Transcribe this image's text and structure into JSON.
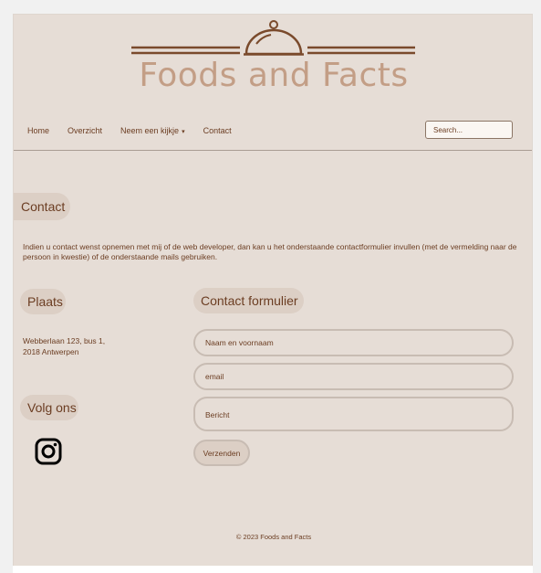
{
  "brand": {
    "name": "Foods and Facts",
    "logo_icon": "cloche-icon",
    "accent": "#7a4a2c",
    "logo_color": "#c39e86"
  },
  "nav": {
    "items": [
      {
        "label": "Home"
      },
      {
        "label": "Overzicht"
      },
      {
        "label": "Neem een kijkje",
        "has_dropdown": true
      },
      {
        "label": "Contact"
      }
    ],
    "search_placeholder": "Search..."
  },
  "contact": {
    "heading": "Contact",
    "intro": "Indien u contact wenst opnemen met mij of de web developer, dan kan u het onderstaande contactformulier invullen (met de vermelding naar de persoon in kwestie) of de onderstaande mails gebruiken."
  },
  "plaats": {
    "heading": "Plaats",
    "address_line1": "Webberlaan 123, bus 1,",
    "address_line2": "2018 Antwerpen"
  },
  "social": {
    "heading": "Volg ons",
    "icon": "instagram-icon"
  },
  "form": {
    "heading": "Contact formulier",
    "name_placeholder": "Naam en voornaam",
    "email_placeholder": "email",
    "message_placeholder": "Bericht",
    "submit_label": "Verzenden"
  },
  "footer": {
    "copyright": "© 2023 Foods and Facts"
  },
  "colors": {
    "background": "#e6ddd6",
    "pill": "#dccfc5",
    "text": "#6b3d22"
  }
}
